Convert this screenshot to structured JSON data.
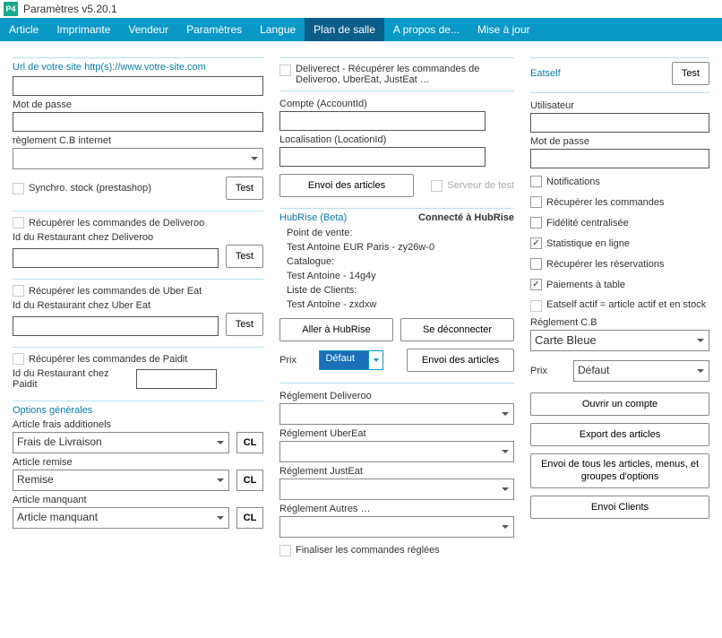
{
  "window": {
    "title": "Paramètres v5.20.1",
    "icon_text": "P4"
  },
  "menu": {
    "items": [
      "Article",
      "Imprimante",
      "Vendeur",
      "Paramètres",
      "Langue",
      "Plan de salle",
      "A propos de...",
      "Mise à jour"
    ],
    "active_index": 5
  },
  "col1": {
    "url_label": "Url de votre site http(s)://www.votre-site.com",
    "url_value": "",
    "pwd_label": "Mot de passe",
    "pwd_value": "",
    "cb_reg_label": "règlement C.B internet",
    "cb_reg_value": "",
    "sync_stock": "Synchro. stock (prestashop)",
    "test": "Test",
    "deliveroo_check": "Récupérer les commandes de Deliveroo",
    "deliveroo_id_label": "Id du Restaurant chez Deliveroo",
    "ubereat_check": "Récupérer les commandes de Uber Eat",
    "ubereat_id_label": "Id du Restaurant chez Uber Eat",
    "paidit_check": "Récupérer les commandes de Paidit",
    "paidit_id_label": "Id du Restaurant chez Paidit",
    "options_header": "Options générales",
    "article_frais_label": "Article frais additionels",
    "article_frais_value": "Frais de Livraison",
    "article_remise_label": "Article remise",
    "article_remise_value": "Remise",
    "article_manquant_label": "Article manquant",
    "article_manquant_value": "Article manquant",
    "cl": "CL"
  },
  "col2": {
    "deliverect_label": "Deliverect  -  Récupérer les commandes de Deliveroo, UberEat, JustEat …",
    "account_label": "Compte (AccountId)",
    "location_label": "Localisation (LocationId)",
    "envoi_articles": "Envoi des articles",
    "server_test": "Serveur de test",
    "hubrise_left": "HubRise (Beta)",
    "hubrise_right": "Connecté à HubRise",
    "pos_label": "Point de vente:",
    "pos_value": "Test Antoine EUR Paris - zy26w-0",
    "catalog_label": "Catalogue:",
    "catalog_value": "Test Antoine - 14g4y",
    "clients_label": "Liste de Clients:",
    "clients_value": "Test Antoine - zxdxw",
    "go_hubrise": "Aller à HubRise",
    "disconnect": "Se déconnecter",
    "prix_label": "Prix",
    "prix_value": "Défaut",
    "reg_deliveroo": "Réglement Deliveroo",
    "reg_ubereat": "Réglement UberEat",
    "reg_justeat": "Réglement JustEat",
    "reg_autres": "Réglement Autres …",
    "finaliser": "Finaliser les commandes réglées"
  },
  "col3": {
    "eatself": "Eatself",
    "test": "Test",
    "user_label": "Utilisateur",
    "pwd_label": "Mot de passe",
    "chk_notifications": "Notifications",
    "chk_recup_cmd": "Récupérer les commandes",
    "chk_fidelite": "Fidélité centralisée",
    "chk_stat": "Statistique en ligne",
    "chk_reserv": "Récupérer les réservations",
    "chk_paiements": "Paiements à table",
    "chk_actif": "Eatself actif = article actif et en stock",
    "reg_cb_label": "Réglement C.B",
    "reg_cb_value": "Carte Bleue",
    "prix_label": "Prix",
    "prix_value": "Défaut",
    "btn_ouvrir": "Ouvrir un compte",
    "btn_export": "Export des articles",
    "btn_envoi_all": "Envoi de tous les articles, menus, et groupes d'options",
    "btn_envoi_clients": "Envoi Clients"
  }
}
